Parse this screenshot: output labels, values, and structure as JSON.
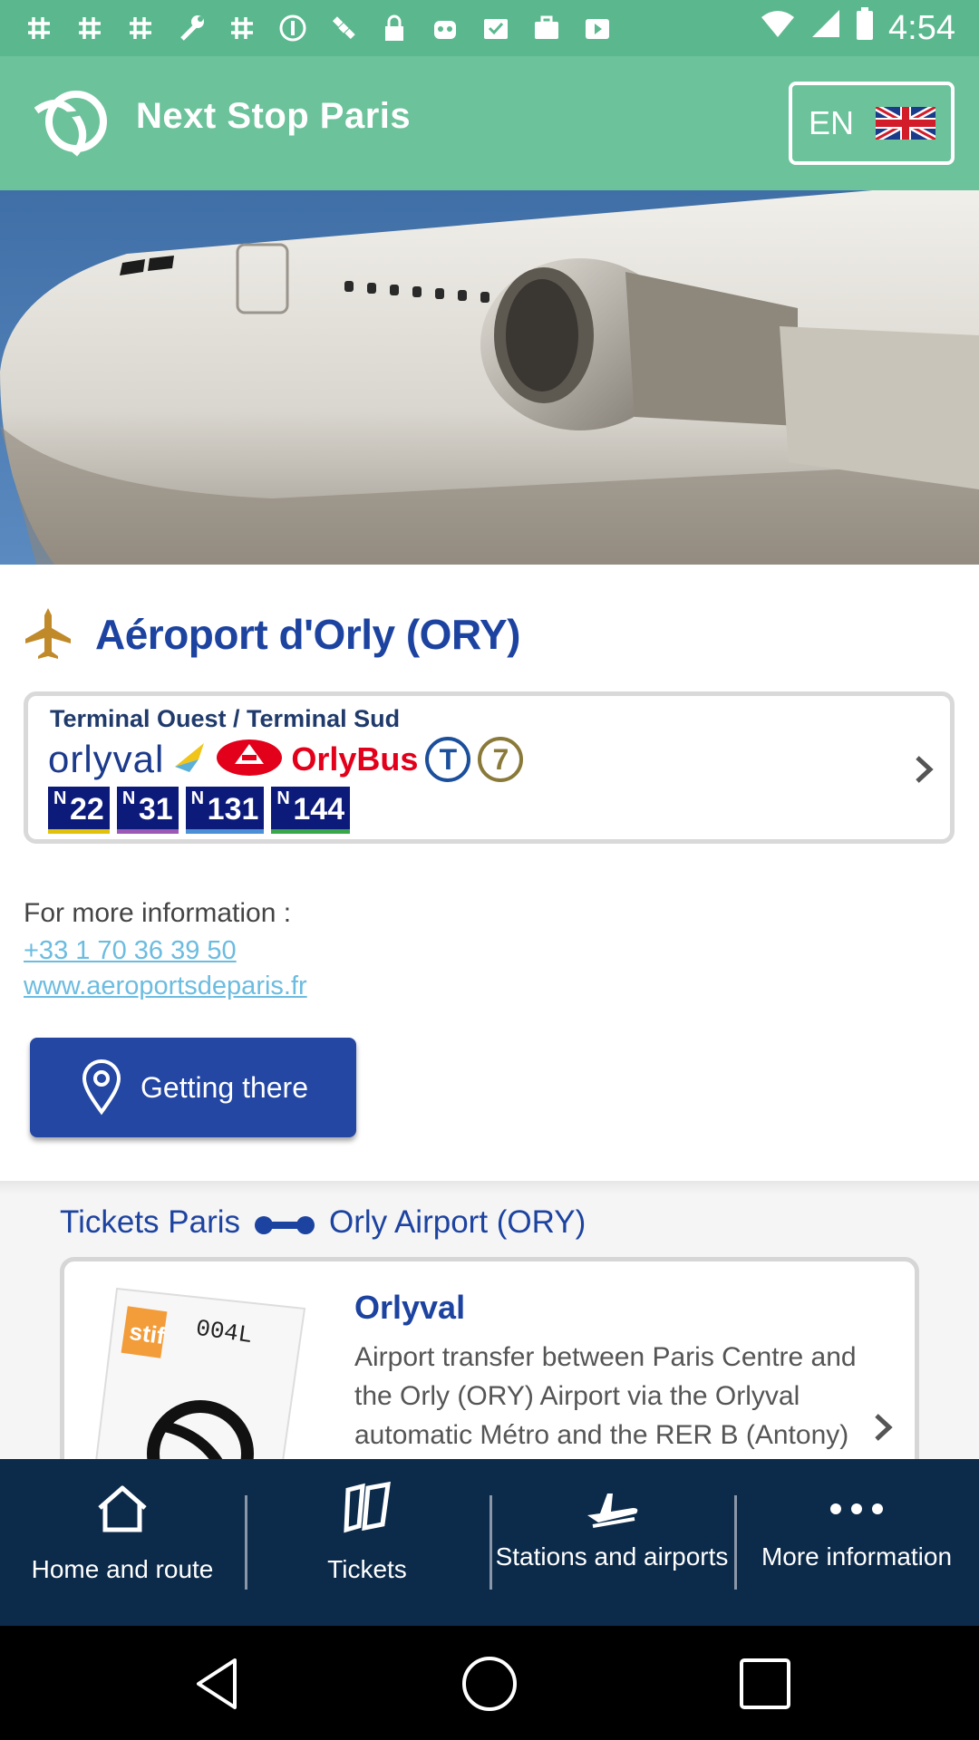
{
  "status_bar": {
    "time": "4:54"
  },
  "app_bar": {
    "title": "Next Stop Paris",
    "language": "EN"
  },
  "airport": {
    "title": "Aéroport d'Orly (ORY)"
  },
  "terminal_card": {
    "title": "Terminal Ouest / Terminal Sud",
    "orlyval_logo": "orlyval",
    "orlybus_logo": "OrlyBus",
    "tram_badge": "T",
    "line_badge": "7",
    "night_buses": [
      {
        "letter": "N",
        "number": "22"
      },
      {
        "letter": "N",
        "number": "31"
      },
      {
        "letter": "N",
        "number": "131"
      },
      {
        "letter": "N",
        "number": "144"
      }
    ]
  },
  "info": {
    "label": "For more information :",
    "phone": "+33 1 70 36 39 50",
    "website": "www.aeroportsdeparis.fr"
  },
  "getting_there_button": {
    "label": "Getting there"
  },
  "tickets_section": {
    "from": "Tickets Paris",
    "to": "Orly Airport (ORY)"
  },
  "ticket_card": {
    "name": "Orlyval",
    "description": "Airport transfer between Paris Centre and the Orly (ORY) Airport via the Orlyval automatic Métro and the RER B (Antony)",
    "ticket_code": "004L",
    "ticket_brand": "stif"
  },
  "bottom_nav": {
    "items": [
      {
        "label": "Home and route",
        "icon": "home-icon"
      },
      {
        "label": "Tickets",
        "icon": "ticket-icon"
      },
      {
        "label": "Stations and airports",
        "icon": "plane-icon"
      },
      {
        "label": "More information",
        "icon": "more-icon"
      }
    ]
  },
  "colors": {
    "app_bar": "#6cc29a",
    "status_bar": "#5bb88e",
    "accent_blue": "#1d43a0",
    "link": "#6cbce0",
    "bottom_nav": "#0c2a4a"
  }
}
